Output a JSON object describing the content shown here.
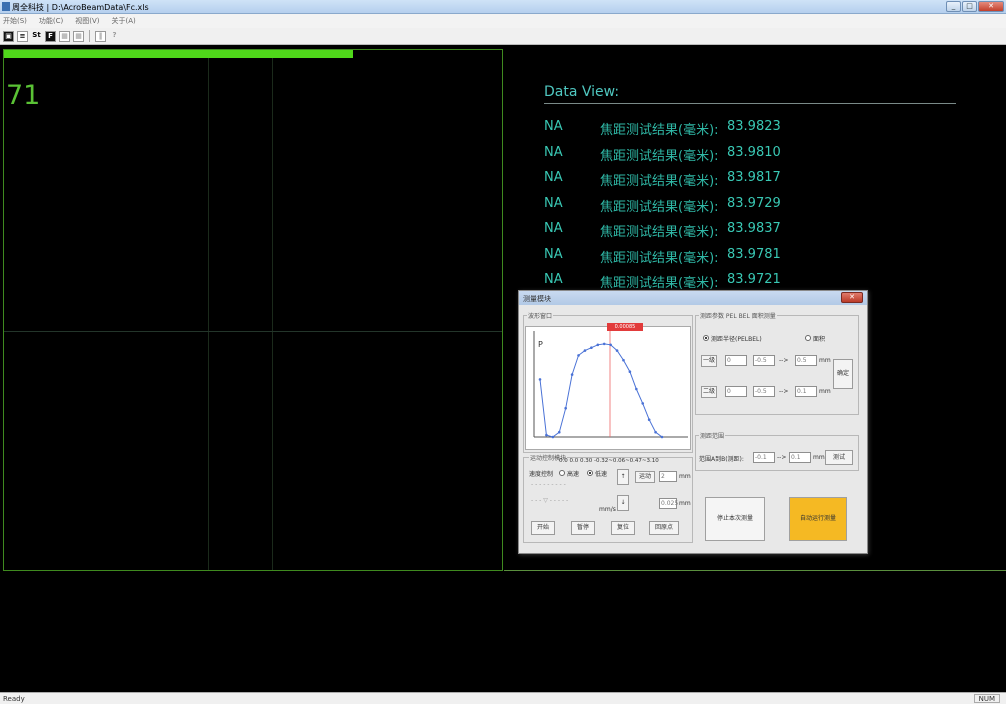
{
  "window": {
    "title": "周全科技 | D:\\AcroBeamData\\Fc.xls"
  },
  "menu": {
    "items": [
      "开始(S)",
      "功能(C)",
      "视图(V)",
      "关于(A)"
    ]
  },
  "toolbar": {
    "buttons": [
      "st-text",
      "doc",
      "St",
      "F",
      "grid",
      "grid2",
      "bars",
      "help"
    ]
  },
  "viewport": {
    "counter": "71",
    "progress_fraction": 0.7
  },
  "data_view": {
    "title": "Data View:",
    "rows": [
      {
        "status": "NA",
        "label": "焦距测试结果(毫米):",
        "value": "83.9823"
      },
      {
        "status": "NA",
        "label": "焦距测试结果(毫米):",
        "value": "83.9810"
      },
      {
        "status": "NA",
        "label": "焦距测试结果(毫米):",
        "value": "83.9817"
      },
      {
        "status": "NA",
        "label": "焦距测试结果(毫米):",
        "value": "83.9729"
      },
      {
        "status": "NA",
        "label": "焦距测试结果(毫米):",
        "value": "83.9837"
      },
      {
        "status": "NA",
        "label": "焦距测试结果(毫米):",
        "value": "83.9781"
      },
      {
        "status": "NA",
        "label": "焦距测试结果(毫米):",
        "value": "83.9721"
      }
    ]
  },
  "dialog": {
    "title": "测量模块",
    "close_label": "✕",
    "plot_group": "波形窗口",
    "peak_label": "0.00085",
    "axis_label": "P",
    "params_group": "测距参数 PEL BEL 面积测量",
    "radio_a": "测距半径(PELBEL)",
    "radio_b": "面积",
    "row1_btn": "一级",
    "row1_a": "0",
    "row1_b": "-0.5",
    "row1_arrow": "-->",
    "row1_c": "0.5",
    "unit_mm": "mm",
    "row2_btn": "二级",
    "row2_a": "0",
    "row2_b": "-0.5",
    "row2_arrow": "-->",
    "row2_c": "0.1",
    "apply_btn": "确定",
    "range_group": "测距范围",
    "range_label": "范围A到B(测距):",
    "range_a": "-0.1",
    "range_arrow": "-->",
    "range_b": "0.1",
    "range_btn": "测试",
    "motor_group": "运动控制模块",
    "coords": "0.0 0.0 0.30 -0.32~0.06~0.47~3.10",
    "speed_label": "速度控制",
    "radio_low": "高速",
    "radio_high": "低速",
    "move_btn": "运动",
    "move_val": "2",
    "step_val": "0.025",
    "unit_mm_short": "mm",
    "unit_mms": "mm/s",
    "up_arrow": "↑",
    "down_arrow": "↓",
    "btn_start": "开始",
    "btn_stop": "暂停",
    "btn_reset": "复位",
    "btn_origin": "回原点",
    "btn_single": "停止本次测量",
    "btn_measure": "自动运行测量",
    "accent_yellow": "#f5b923"
  },
  "status": {
    "text": "Ready",
    "num": "NUM"
  },
  "chart_data": {
    "type": "line",
    "x": [
      0,
      1,
      2,
      3,
      4,
      5,
      6,
      7,
      8,
      9,
      10,
      11,
      12,
      13,
      14,
      15,
      16,
      17,
      18,
      19
    ],
    "values": [
      0.6,
      0.02,
      0.0,
      0.05,
      0.3,
      0.65,
      0.85,
      0.9,
      0.93,
      0.96,
      0.97,
      0.96,
      0.9,
      0.8,
      0.68,
      0.5,
      0.35,
      0.18,
      0.05,
      0.0
    ]
  }
}
